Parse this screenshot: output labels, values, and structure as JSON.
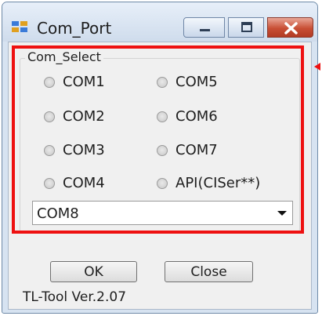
{
  "window": {
    "title": "Com_Port",
    "icon": "app-icon",
    "controls": [
      "minimize-icon",
      "maximize-icon",
      "close-icon"
    ]
  },
  "group": {
    "title": "Com_Select",
    "options": [
      {
        "label": "COM1",
        "selected": false
      },
      {
        "label": "COM2",
        "selected": false
      },
      {
        "label": "COM3",
        "selected": false
      },
      {
        "label": "COM4",
        "selected": false
      },
      {
        "label": "COM5",
        "selected": false
      },
      {
        "label": "COM6",
        "selected": false
      },
      {
        "label": "COM7",
        "selected": false
      },
      {
        "label": "API(CISer**)",
        "selected": false
      }
    ]
  },
  "combo": {
    "value": "COM8"
  },
  "buttons": {
    "ok": "OK",
    "close": "Close"
  },
  "version": "TL-Tool Ver.2.07",
  "colors": {
    "highlight": "#ee1111",
    "close_button": "#c84f35",
    "window_frame": "#d7e3f1"
  }
}
